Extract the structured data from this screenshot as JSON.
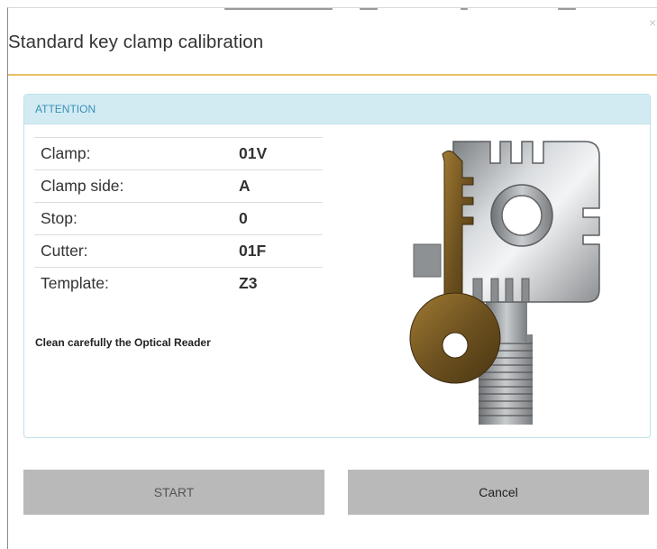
{
  "dialog": {
    "title": "Standard key clamp calibration",
    "close_glyph": "×"
  },
  "panel": {
    "header": "ATTENTION",
    "rows": [
      {
        "label": "Clamp:",
        "value": "01V"
      },
      {
        "label": "Clamp side:",
        "value": "A"
      },
      {
        "label": "Stop:",
        "value": "0"
      },
      {
        "label": "Cutter:",
        "value": "01F"
      },
      {
        "label": "Template:",
        "value": "Z3"
      }
    ],
    "note": "Clean carefully the Optical Reader",
    "image_icon": "key-clamp-illustration"
  },
  "buttons": {
    "start_label": "START",
    "cancel_label": "Cancel"
  },
  "colors": {
    "title_underline": "#e6c065",
    "panel_header_bg": "#d2ebf3",
    "panel_header_text": "#3a8fb8",
    "button_bg": "#b9b9b9"
  }
}
